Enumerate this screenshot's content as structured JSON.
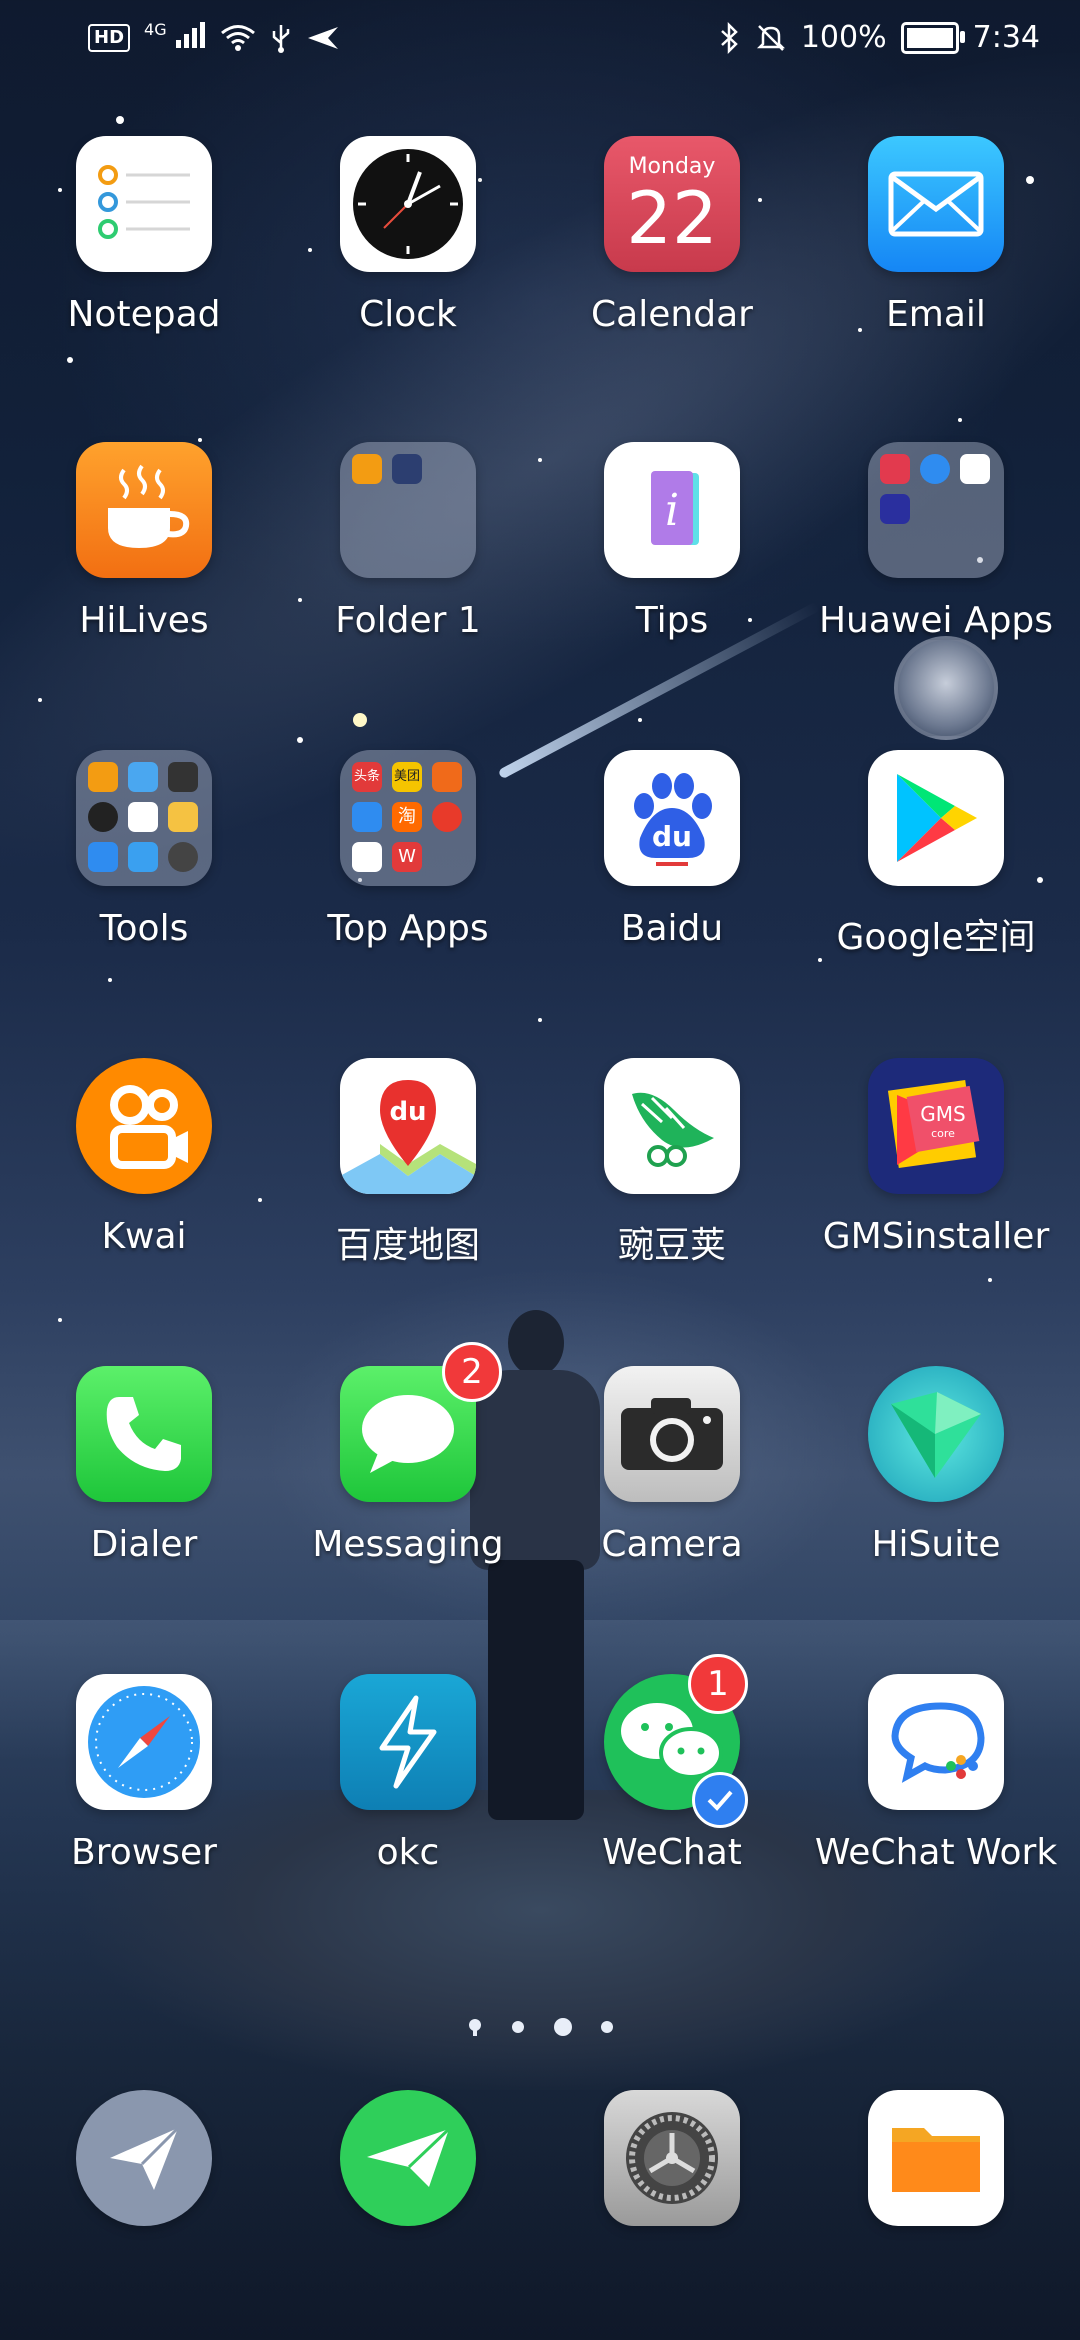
{
  "status_bar": {
    "hd": "HD",
    "network": "4G",
    "battery_percent": "100%",
    "time": "7:34"
  },
  "apps": [
    {
      "label": "Notepad",
      "icon": "notepad-icon"
    },
    {
      "label": "Clock",
      "icon": "clock-icon"
    },
    {
      "label": "Calendar",
      "icon": "calendar-icon",
      "day_name": "Monday",
      "day_number": "22"
    },
    {
      "label": "Email",
      "icon": "email-icon"
    },
    {
      "label": "HiLives",
      "icon": "hilives-icon"
    },
    {
      "label": "Folder 1",
      "icon": "folder-icon"
    },
    {
      "label": "Tips",
      "icon": "tips-icon"
    },
    {
      "label": "Huawei Apps",
      "icon": "folder-icon"
    },
    {
      "label": "Tools",
      "icon": "folder-icon"
    },
    {
      "label": "Top Apps",
      "icon": "folder-icon"
    },
    {
      "label": "Baidu",
      "icon": "baidu-icon",
      "icon_text": "du"
    },
    {
      "label": "Google空间",
      "icon": "google-play-icon"
    },
    {
      "label": "Kwai",
      "icon": "kwai-icon"
    },
    {
      "label": "百度地图",
      "icon": "baidu-maps-icon",
      "icon_text": "du"
    },
    {
      "label": "豌豆荚",
      "icon": "wandoujia-icon"
    },
    {
      "label": "GMSinstaller",
      "icon": "gms-installer-icon",
      "icon_text": "GMS",
      "icon_subtext": "core"
    },
    {
      "label": "Dialer",
      "icon": "phone-icon"
    },
    {
      "label": "Messaging",
      "icon": "messaging-icon",
      "badge": "2"
    },
    {
      "label": "Camera",
      "icon": "camera-icon"
    },
    {
      "label": "HiSuite",
      "icon": "hisuite-icon"
    },
    {
      "label": "Browser",
      "icon": "compass-icon"
    },
    {
      "label": "okc",
      "icon": "okc-icon"
    },
    {
      "label": "WeChat",
      "icon": "wechat-icon",
      "badge": "1"
    },
    {
      "label": "WeChat Work",
      "icon": "wechat-work-icon"
    }
  ],
  "top_apps_folder_labels": [
    "头条",
    "美团",
    "淘",
    "W"
  ],
  "dock": [
    {
      "icon": "paper-plane-icon"
    },
    {
      "icon": "send-arrow-icon"
    },
    {
      "icon": "settings-icon"
    },
    {
      "icon": "files-icon"
    }
  ],
  "page_indicator": {
    "pages": 4,
    "current": 3
  }
}
